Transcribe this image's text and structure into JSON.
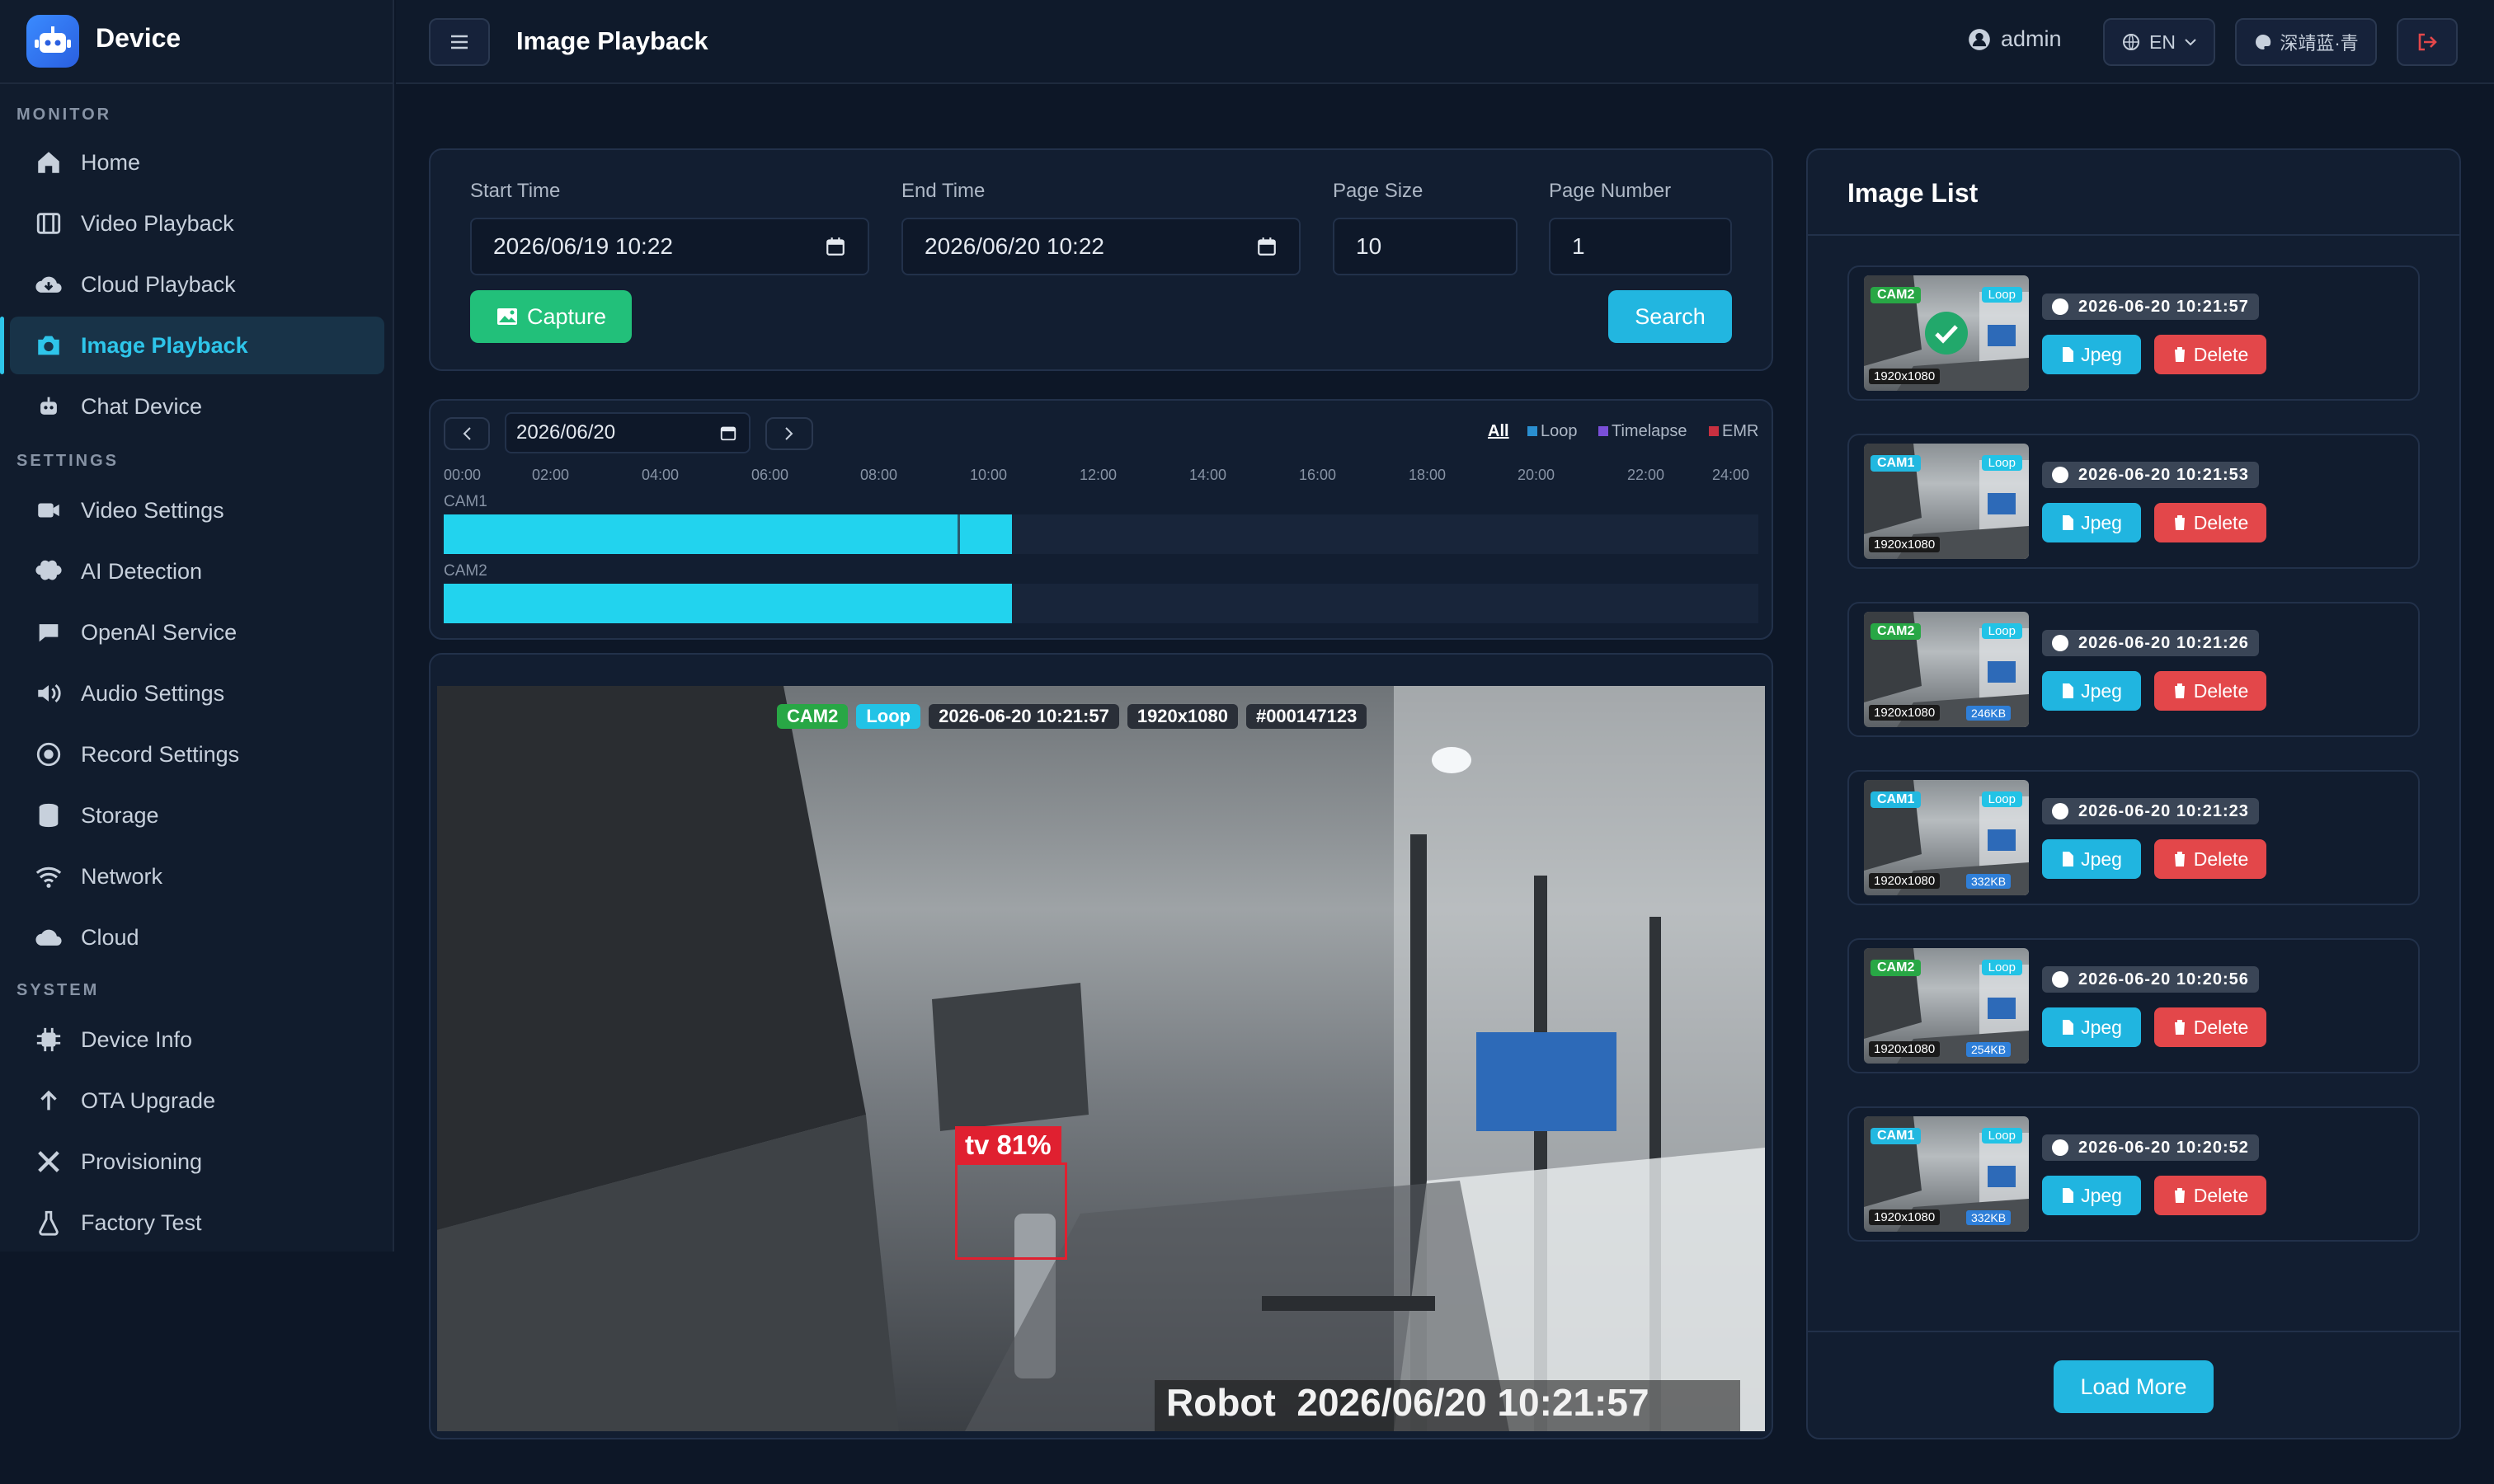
{
  "app": {
    "name": "Device"
  },
  "sidebar": {
    "sections": {
      "monitor": "MONITOR",
      "settings": "SETTINGS",
      "system": "SYSTEM"
    },
    "items": [
      "Home",
      "Video Playback",
      "Cloud Playback",
      "Image Playback",
      "Chat Device",
      "Video Settings",
      "AI Detection",
      "OpenAI Service",
      "Audio Settings",
      "Record Settings",
      "Storage",
      "Network",
      "Cloud",
      "Device Info",
      "OTA Upgrade",
      "Provisioning",
      "Factory Test"
    ]
  },
  "topbar": {
    "title": "Image Playback",
    "user": "admin",
    "lang": "EN",
    "theme": "深靖蓝·青"
  },
  "filter": {
    "start_label": "Start Time",
    "start_value": "2026/06/19 10:22",
    "end_label": "End Time",
    "end_value": "2026/06/20 10:22",
    "size_label": "Page Size",
    "size_value": "10",
    "page_label": "Page Number",
    "page_value": "1",
    "capture": "Capture",
    "search": "Search"
  },
  "timeline": {
    "date": "2026/06/20",
    "legend": {
      "all": "All",
      "loop": "Loop",
      "timelapse": "Timelapse",
      "emr": "EMR"
    },
    "ticks": [
      "00:00",
      "02:00",
      "04:00",
      "06:00",
      "08:00",
      "10:00",
      "12:00",
      "14:00",
      "16:00",
      "18:00",
      "20:00",
      "22:00",
      "24:00"
    ],
    "cam1": "CAM1",
    "cam2": "CAM2",
    "coverage_fraction": 0.432,
    "marker_fraction": 0.391
  },
  "viewer": {
    "cam": "CAM2",
    "mode": "Loop",
    "time": "2026-06-20 10:21:57",
    "res": "1920x1080",
    "id": "#000147123",
    "detect": "tv 81%",
    "watermark": "Robot  2026/06/20 10:21:57"
  },
  "list": {
    "title": "Image List",
    "jpeg": "Jpeg",
    "delete": "Delete",
    "load_more": "Load More",
    "items": [
      {
        "cam": "CAM2",
        "mode": "Loop",
        "res": "1920x1080",
        "size": "",
        "time": "2026-06-20 10:21:57"
      },
      {
        "cam": "CAM1",
        "mode": "Loop",
        "res": "1920x1080",
        "size": "",
        "time": "2026-06-20 10:21:53"
      },
      {
        "cam": "CAM2",
        "mode": "Loop",
        "res": "1920x1080",
        "size": "246KB",
        "time": "2026-06-20 10:21:26"
      },
      {
        "cam": "CAM1",
        "mode": "Loop",
        "res": "1920x1080",
        "size": "332KB",
        "time": "2026-06-20 10:21:23"
      },
      {
        "cam": "CAM2",
        "mode": "Loop",
        "res": "1920x1080",
        "size": "254KB",
        "time": "2026-06-20 10:20:56"
      },
      {
        "cam": "CAM1",
        "mode": "Loop",
        "res": "1920x1080",
        "size": "332KB",
        "time": "2026-06-20 10:20:52"
      }
    ]
  },
  "colors": {
    "accent": "#2ec5ea",
    "bar": "#22d3ee",
    "capture": "#22c07a",
    "delete": "#e3474a",
    "cam1": "#22b8e0",
    "cam2": "#28a745",
    "detect": "#e02030"
  }
}
